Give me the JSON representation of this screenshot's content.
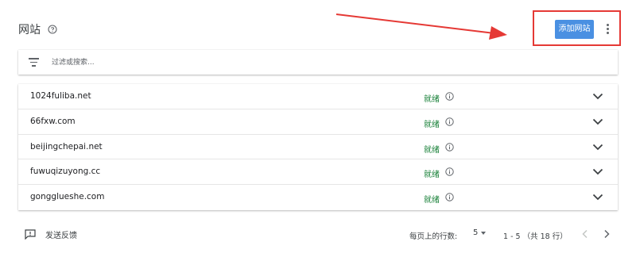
{
  "header": {
    "title": "网站",
    "add_button_label": "添加网站"
  },
  "filter": {
    "placeholder": "过滤或搜索..."
  },
  "sites": [
    {
      "domain": "1024fuliba.net",
      "status": "就绪"
    },
    {
      "domain": "66fxw.com",
      "status": "就绪"
    },
    {
      "domain": "beijingchepai.net",
      "status": "就绪"
    },
    {
      "domain": "fuwuqizuyong.cc",
      "status": "就绪"
    },
    {
      "domain": "gongglueshe.com",
      "status": "就绪"
    }
  ],
  "footer": {
    "feedback_label": "发送反馈",
    "rows_per_page_label": "每页上的行数:",
    "rows_per_page_value": "5",
    "range_label": "1 - 5 （共 18 行）"
  },
  "colors": {
    "accent_button": "#4a90e2",
    "status_ready": "#188038",
    "annotation_red": "#e53935"
  },
  "icons": {
    "help": "help-circle-icon",
    "more": "more-vert-icon",
    "filter": "filter-list-icon",
    "info": "info-icon",
    "expand": "chevron-down-icon",
    "feedback": "feedback-icon",
    "prev": "chevron-left-icon",
    "next": "chevron-right-icon"
  }
}
